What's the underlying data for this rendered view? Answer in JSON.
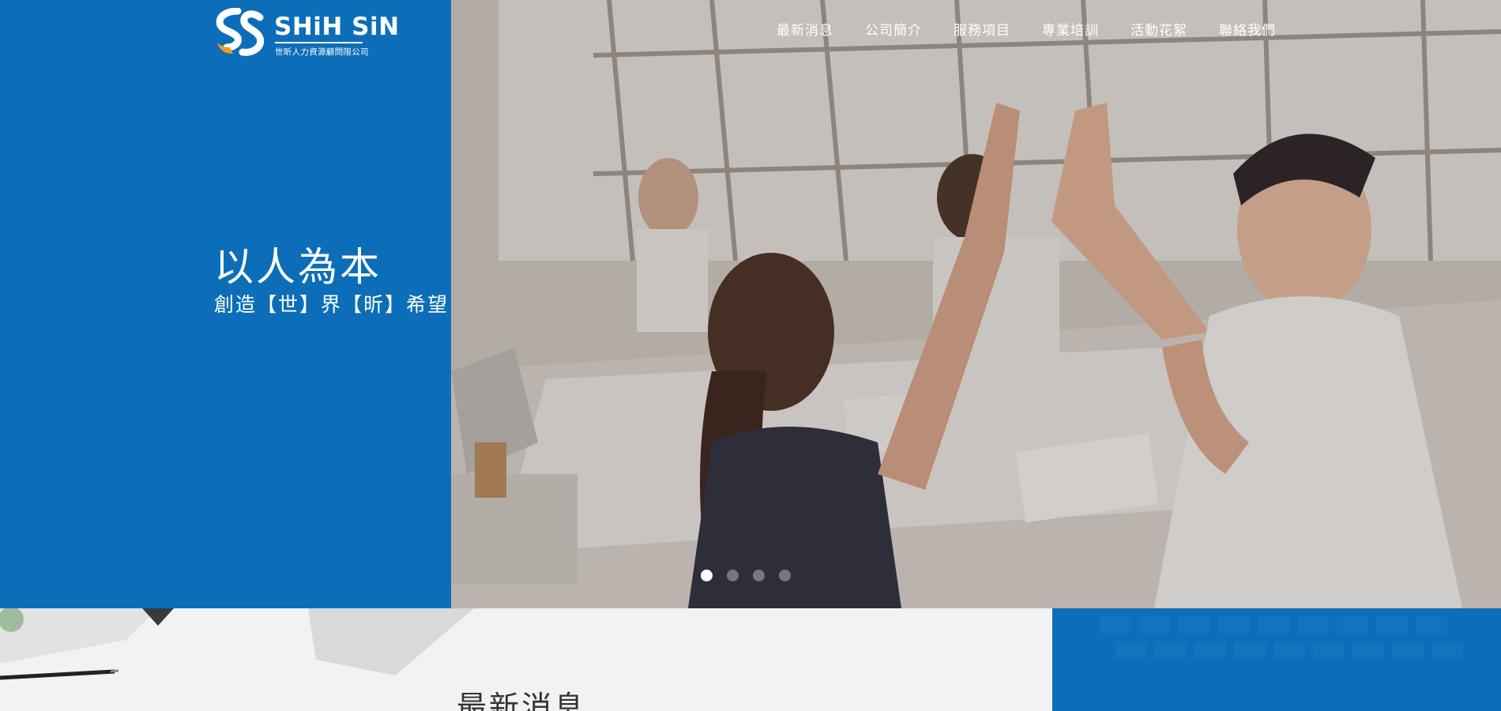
{
  "brand": {
    "name_en": "SHiH SiN",
    "name_zh": "世昕人力資源顧問限公司"
  },
  "nav": {
    "items": [
      {
        "label": "最新消息"
      },
      {
        "label": "公司簡介"
      },
      {
        "label": "服務項目"
      },
      {
        "label": "專業培訓"
      },
      {
        "label": "活動花絮"
      },
      {
        "label": "聯絡我們"
      }
    ]
  },
  "hero": {
    "headline": "以人為本",
    "subheadline": "創造【世】界【昕】希望",
    "carousel": {
      "slide_count": 4,
      "active_index": 0
    }
  },
  "news": {
    "title": "最新消息"
  },
  "colors": {
    "brand_blue": "#0c6eb8",
    "accent_orange": "#f39a1e",
    "white": "#ffffff"
  }
}
